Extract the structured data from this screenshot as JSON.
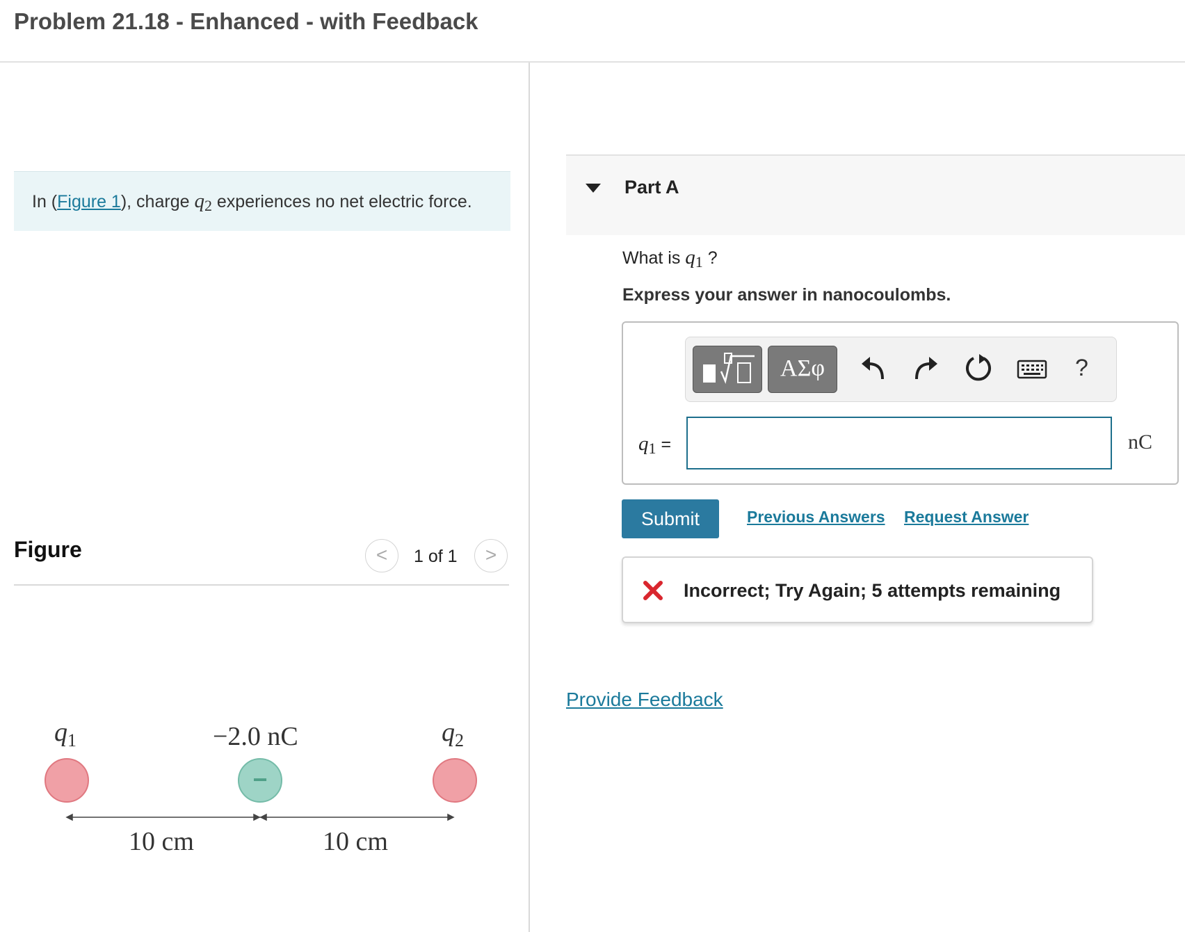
{
  "header": {
    "title": "Problem 21.18 - Enhanced - with Feedback"
  },
  "intro": {
    "prefix": "In (",
    "figure_link": "Figure 1",
    "middle": "), charge ",
    "var": "q",
    "var_sub": "2",
    "suffix": " experiences no net electric force."
  },
  "figure": {
    "title": "Figure",
    "pager": {
      "text": "1 of 1",
      "prev_glyph": "<",
      "next_glyph": ">"
    },
    "diagram": {
      "q1_label": "q",
      "q1_sub": "1",
      "middle_label": "−2.0 nC",
      "middle_sign": "−",
      "q2_label": "q",
      "q2_sub": "2",
      "left_distance": "10 cm",
      "right_distance": "10 cm",
      "colors": {
        "positive": "#f0a0a6",
        "positive_stroke": "#e07880",
        "negative": "#9ed4c6",
        "negative_stroke": "#74bba8",
        "negative_sign": "#4fa088"
      }
    }
  },
  "partA": {
    "title": "Part A",
    "question_prefix": "What is ",
    "question_var": "q",
    "question_sub": "1",
    "question_suffix": " ?",
    "instruction": "Express your answer in nanocoulombs.",
    "toolbar": {
      "greek_label": "ΑΣφ",
      "help_label": "?",
      "icons": [
        "templates-icon",
        "greek-symbols-icon",
        "undo-icon",
        "redo-icon",
        "reset-icon",
        "keyboard-icon",
        "help-icon"
      ]
    },
    "answer": {
      "var": "q",
      "var_sub": "1",
      "equals": "=",
      "value": "",
      "unit": "nC"
    },
    "submit_label": "Submit",
    "previous_answers_label": "Previous Answers",
    "request_answer_label": "Request Answer",
    "feedback_text": "Incorrect; Try Again; 5 attempts remaining"
  },
  "provide_feedback_label": "Provide Feedback",
  "colors": {
    "accent": "#2b7aa0",
    "link": "#1b7a9b",
    "incorrect": "#d9262e",
    "intro_bg": "#eaf5f7"
  }
}
